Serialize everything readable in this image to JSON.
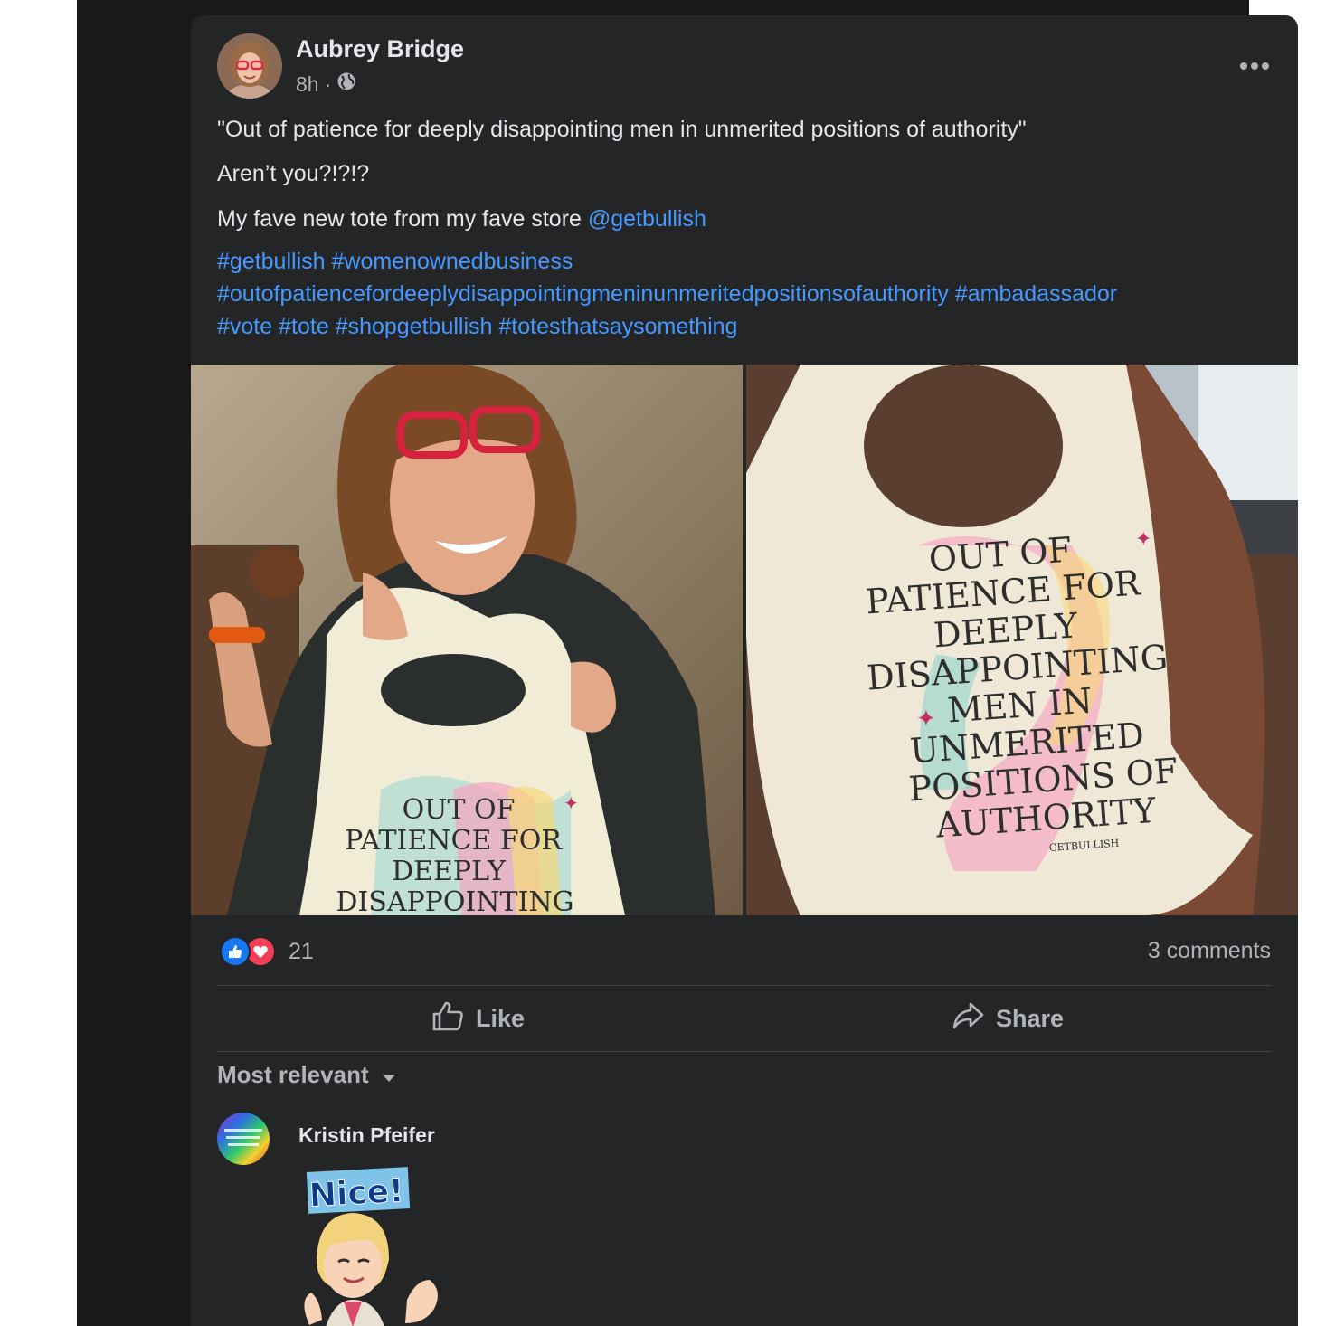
{
  "post": {
    "author": "Aubrey Bridge",
    "time": "8h",
    "separator": "·",
    "audience_icon": "globe-icon",
    "more_icon": "more-options-icon",
    "text": {
      "line1": "\"Out of patience for deeply disappointing men in unmerited positions of authority\"",
      "line2": "Aren’t you?!?!?",
      "line3_prefix": "My fave new tote from my fave store ",
      "line3_mention": "@getbullish"
    },
    "hashtags": [
      "#getbullish",
      "#womenownedbusiness",
      "#outofpatiencefordeeplydisappointingmeninunmeritedpositionsofauthority",
      "#ambadassador",
      "#vote",
      "#tote",
      "#shopgetbullish",
      "#totesthatsaysomething"
    ],
    "images": [
      {
        "tote_text": [
          "OUT OF",
          "PATIENCE FOR",
          "DEEPLY",
          "DISAPPOINTING"
        ]
      },
      {
        "tote_text": [
          "OUT OF",
          "PATIENCE FOR",
          "DEEPLY",
          "DISAPPOINTING",
          "MEN IN",
          "UNMERITED",
          "POSITIONS OF",
          "AUTHORITY"
        ],
        "brand": "GETBULLISH"
      }
    ]
  },
  "reactions": {
    "count": "21",
    "icons": [
      "like-icon",
      "love-icon"
    ],
    "colors": {
      "like": "#1877f2",
      "love": "#f33e58"
    }
  },
  "comments_count": "3 comments",
  "actions": {
    "like": "Like",
    "share": "Share"
  },
  "comments": {
    "sort_label": "Most relevant",
    "items": [
      {
        "author": "Kristin Pfeifer",
        "sticker_text": "Nice!"
      }
    ]
  },
  "colors": {
    "background": "#18191a",
    "card": "#242526",
    "link": "#4599ff",
    "text": "#e4e6eb",
    "muted": "#b0b3b8"
  }
}
